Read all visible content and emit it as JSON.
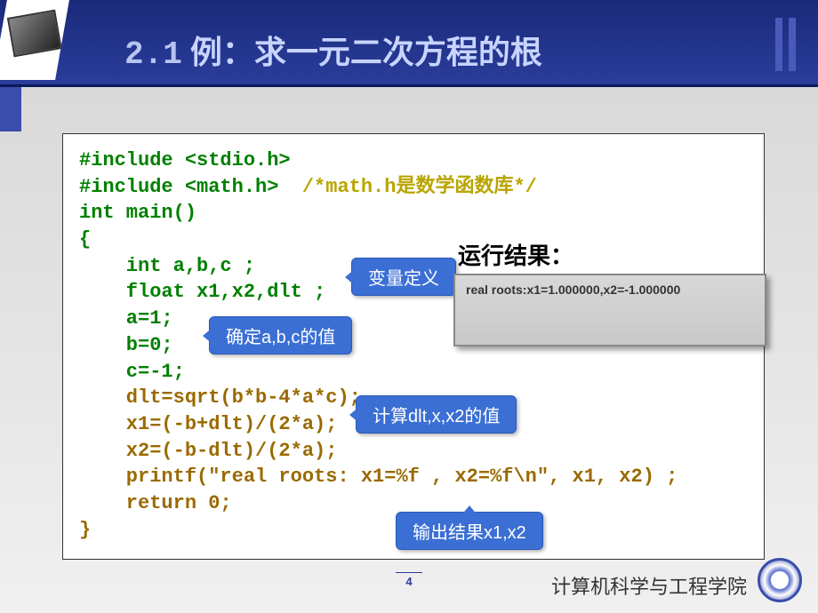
{
  "header": {
    "section_num": "2.1",
    "title": "例：求一元二次方程的根"
  },
  "code": {
    "l1a": "#include <stdio.h>",
    "l2a": "#include <math.h>",
    "l2b": "  /*math.h是数学函数库*/",
    "l3": "int main()",
    "l4": "{",
    "l5": "    int a,b,c ;",
    "l6": "    float x1,x2,dlt ;",
    "l7": "    a=1;",
    "l8": "    b=0;",
    "l9": "    c=-1;",
    "l10": "    dlt=sqrt(b*b-4*a*c);",
    "l11": "    x1=(-b+dlt)/(2*a);",
    "l12": "    x2=(-b-dlt)/(2*a);",
    "l13": "    printf(\"real roots: x1=%f , x2=%f\\n\", x1, x2) ;",
    "l14": "    return 0;",
    "l15": "}"
  },
  "callouts": {
    "c1": "变量定义",
    "c2": "确定a,b,c的值",
    "c3": "计算dlt,x,x2的值",
    "c4": "输出结果x1,x2"
  },
  "result": {
    "label": "运行结果：",
    "output": "real roots:x1=1.000000,x2=-1.000000"
  },
  "footer": {
    "page": "4",
    "org": "计算机科学与工程学院"
  }
}
